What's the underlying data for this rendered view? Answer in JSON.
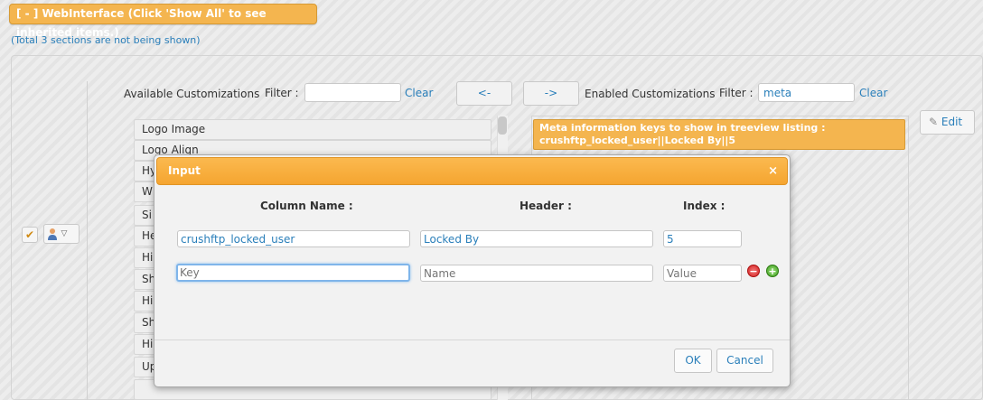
{
  "section": {
    "title": "[ - ] WebInterface (Click 'Show All' to see inherited items.)",
    "hidden_note": "(Total 3 sections are not being shown)"
  },
  "available": {
    "label": "Available Customizations",
    "filter_label": "Filter :",
    "filter_value": "",
    "clear_label": "Clear",
    "items": [
      "Logo Image",
      "Logo Align",
      "Hy",
      "W",
      "Si",
      "He",
      "Hi",
      "Sh",
      "Hi",
      "Sh",
      "Hi",
      "Up",
      ""
    ]
  },
  "move_buttons": {
    "left_label": "<-",
    "right_label": "->"
  },
  "enabled": {
    "label": "Enabled Customizations",
    "filter_label": "Filter :",
    "filter_value": "meta",
    "clear_label": "Clear",
    "item_line1": "Meta information keys to show in treeview listing :",
    "item_line2": "crushftp_locked_user||Locked By||5"
  },
  "edit_label": "Edit",
  "modal": {
    "title": "Input",
    "close_glyph": "×",
    "headers": {
      "column_name": "Column Name :",
      "header": "Header :",
      "index": "Index :"
    },
    "row1": {
      "column_name": "crushftp_locked_user",
      "header": "Locked By",
      "index": "5"
    },
    "row2": {
      "column_name": "",
      "header": "",
      "index": "",
      "placeholder_key": "Key",
      "placeholder_name": "Name",
      "placeholder_value": "Value"
    },
    "ok_label": "OK",
    "cancel_label": "Cancel"
  },
  "icons": {
    "check": "checkmark-icon",
    "user": "user-icon",
    "dropdown": "triangle-down-icon",
    "edit": "pencil-icon",
    "remove": "remove-icon",
    "add": "add-icon"
  },
  "colors": {
    "accent_orange": "#f4b54f",
    "link_blue": "#2a7fba"
  }
}
